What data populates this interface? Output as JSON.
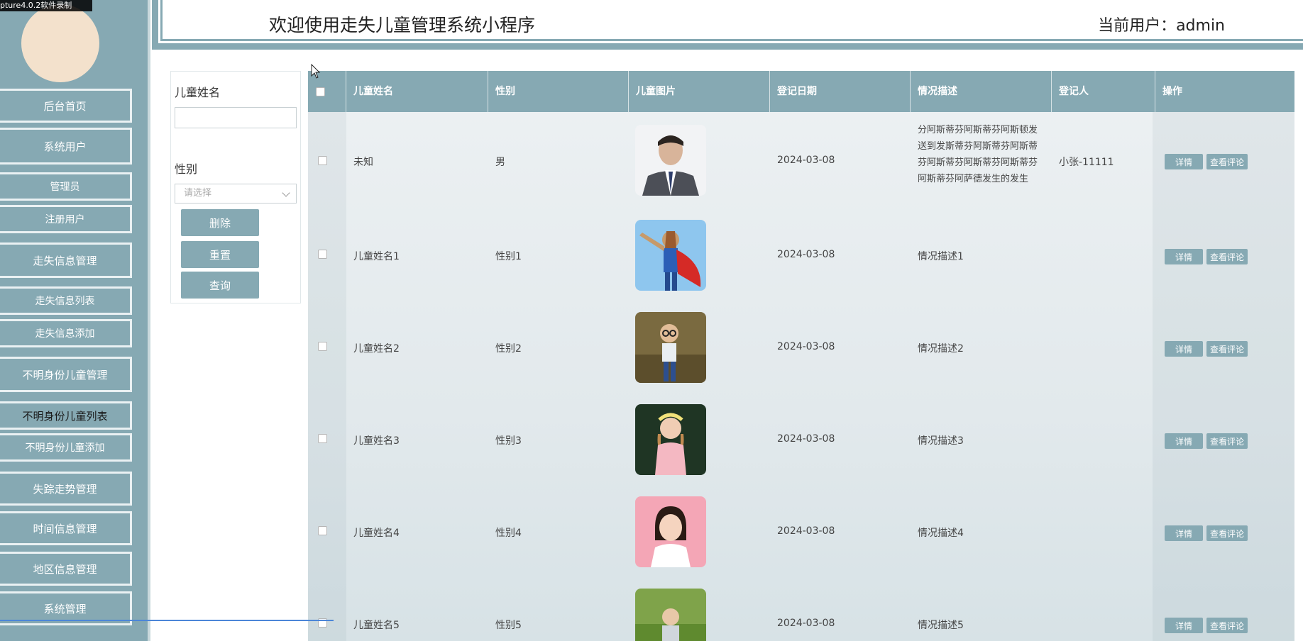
{
  "recorder": {
    "text": "pture4.0.2软件录制"
  },
  "header": {
    "title": "欢迎使用走失儿童管理系统小程序",
    "user": "当前用户：admin"
  },
  "sidebar": {
    "items": [
      {
        "label": "后台首页"
      },
      {
        "label": "系统用户"
      },
      {
        "label": "管理员"
      },
      {
        "label": "注册用户"
      },
      {
        "label": "走失信息管理"
      },
      {
        "label": "走失信息列表"
      },
      {
        "label": "走失信息添加"
      },
      {
        "label": "不明身份儿童管理"
      },
      {
        "label": "不明身份儿童列表"
      },
      {
        "label": "不明身份儿童添加"
      },
      {
        "label": "失踪走势管理"
      },
      {
        "label": "时间信息管理"
      },
      {
        "label": "地区信息管理"
      },
      {
        "label": "系统管理"
      }
    ]
  },
  "search": {
    "name_label": "儿童姓名",
    "name_value": "",
    "gender_label": "性别",
    "gender_placeholder": "请选择",
    "delete_label": "删除",
    "reset_label": "重置",
    "query_label": "查询"
  },
  "table": {
    "headers": [
      "儿童姓名",
      "性别",
      "儿童图片",
      "登记日期",
      "情况描述",
      "登记人",
      "操作"
    ],
    "detail_label": "详情",
    "comment_label": "查看评论",
    "rows": [
      {
        "name": "未知",
        "gender": "男",
        "date": "2024-03-08",
        "desc": "分阿斯蒂芬阿斯蒂芬阿斯顿发送到发斯蒂芬阿斯蒂芬阿斯蒂芬阿斯蒂芬阿斯蒂芬阿斯蒂芬阿斯蒂芬阿萨德发生的发生",
        "registrant": "小张-11111"
      },
      {
        "name": "儿童姓名1",
        "gender": "性别1",
        "date": "2024-03-08",
        "desc": "情况描述1",
        "registrant": ""
      },
      {
        "name": "儿童姓名2",
        "gender": "性别2",
        "date": "2024-03-08",
        "desc": "情况描述2",
        "registrant": ""
      },
      {
        "name": "儿童姓名3",
        "gender": "性别3",
        "date": "2024-03-08",
        "desc": "情况描述3",
        "registrant": ""
      },
      {
        "name": "儿童姓名4",
        "gender": "性别4",
        "date": "2024-03-08",
        "desc": "情况描述4",
        "registrant": ""
      },
      {
        "name": "儿童姓名5",
        "gender": "性别5",
        "date": "2024-03-08",
        "desc": "情况描述5",
        "registrant": ""
      }
    ]
  },
  "colors": {
    "accent": "#86a9b3"
  }
}
